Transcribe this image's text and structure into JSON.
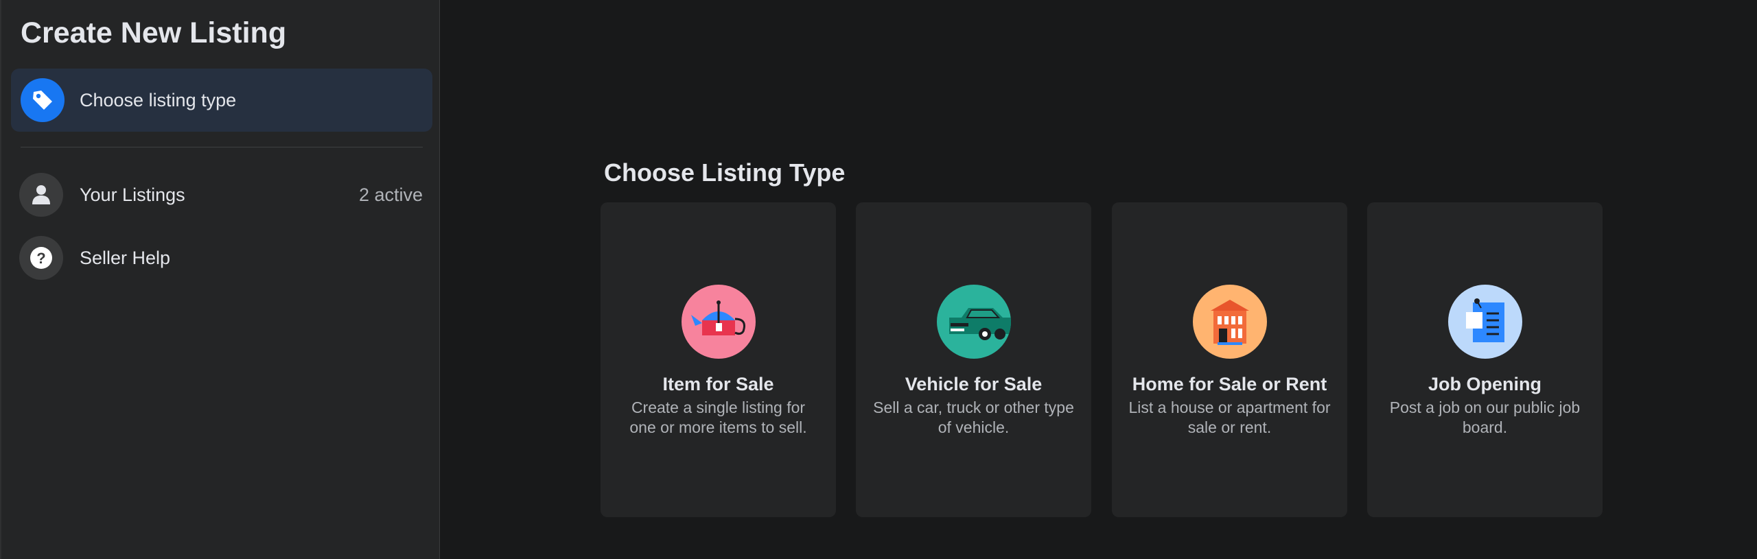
{
  "sidebar": {
    "title": "Create New Listing",
    "active_item": {
      "label": "Choose listing type",
      "icon": "tag-icon"
    },
    "items": [
      {
        "label": "Your Listings",
        "meta": "2 active",
        "icon": "person-icon"
      },
      {
        "label": "Seller Help",
        "icon": "question-icon"
      }
    ]
  },
  "main": {
    "title": "Choose Listing Type",
    "cards": [
      {
        "title": "Item for Sale",
        "description": "Create a single listing for one or more items to sell.",
        "icon": "teapot-icon",
        "color": "#f7839d"
      },
      {
        "title": "Vehicle for Sale",
        "description": "Sell a car, truck or other type of vehicle.",
        "icon": "car-icon",
        "color": "#2bb39c"
      },
      {
        "title": "Home for Sale or Rent",
        "description": "List a house or apartment for sale or rent.",
        "icon": "house-icon",
        "color": "#ffb470"
      },
      {
        "title": "Job Opening",
        "description": "Post a job on our public job board.",
        "icon": "job-board-icon",
        "color": "#bcd9fb"
      }
    ]
  },
  "colors": {
    "accent": "#1877f2",
    "background": "#18191a",
    "panel": "#242526",
    "active_row": "#263040"
  }
}
